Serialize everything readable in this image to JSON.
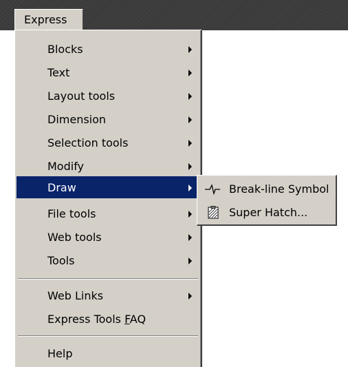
{
  "menubar": {
    "title": "Express"
  },
  "menu": {
    "items": [
      {
        "label": "Blocks",
        "submenu": true
      },
      {
        "label": "Text",
        "submenu": true
      },
      {
        "label": "Layout tools",
        "submenu": true
      },
      {
        "label": "Dimension",
        "submenu": true
      },
      {
        "label": "Selection tools",
        "submenu": true
      },
      {
        "label": "Modify",
        "submenu": true
      },
      {
        "label": "Draw",
        "submenu": true,
        "active": true
      },
      {
        "label": "File tools",
        "submenu": true
      },
      {
        "label": "Web tools",
        "submenu": true
      },
      {
        "label": "Tools",
        "submenu": true
      },
      {
        "label": "Web Links",
        "submenu": true
      },
      {
        "label_prefix": "Express Tools ",
        "label_mnemonic": "F",
        "label_suffix": "AQ",
        "submenu": false
      },
      {
        "label": "Help",
        "submenu": false
      }
    ]
  },
  "draw_submenu": {
    "items": [
      {
        "label": "Break-line Symbol",
        "icon": "break-line-icon"
      },
      {
        "label": "Super Hatch...",
        "icon": "super-hatch-icon"
      }
    ]
  },
  "colors": {
    "menu_bg": "#d4d0c8",
    "highlight": "#0a246a",
    "menubar_bg": "#3a3a3a"
  }
}
